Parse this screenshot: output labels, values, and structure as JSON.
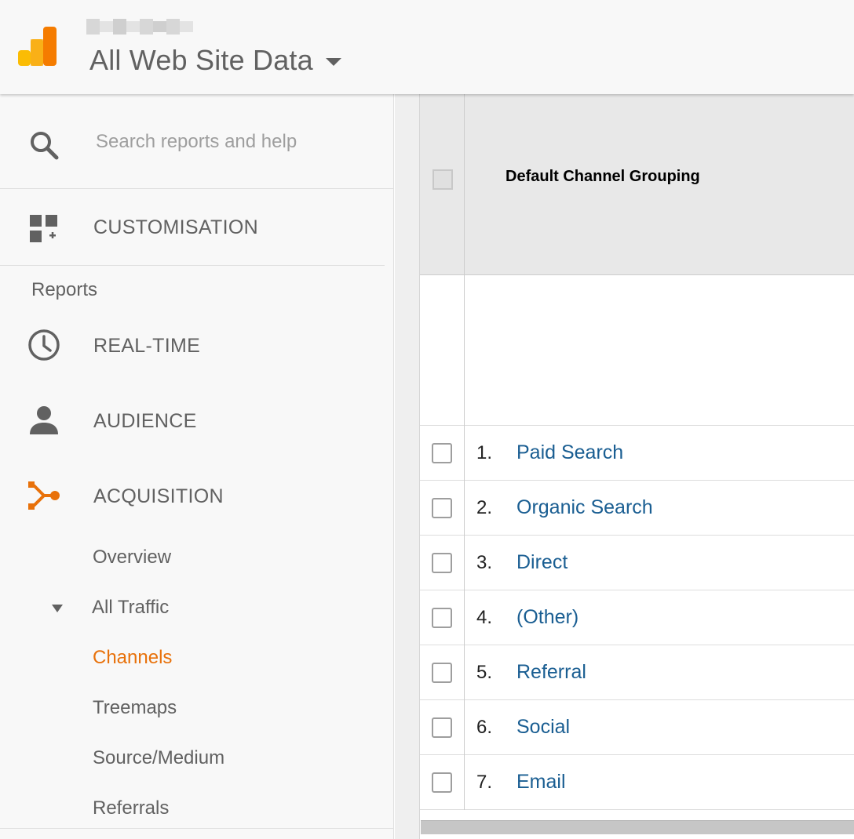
{
  "header": {
    "property_title": "All Web Site Data"
  },
  "sidebar": {
    "search": {
      "placeholder": "Search reports and help"
    },
    "customisation_label": "CUSTOMISATION",
    "reports_title": "Reports",
    "nav": [
      {
        "label": "REAL-TIME",
        "icon": "clock-icon"
      },
      {
        "label": "AUDIENCE",
        "icon": "person-icon"
      },
      {
        "label": "ACQUISITION",
        "icon": "acquisition-icon",
        "active": true
      }
    ],
    "acquisition": {
      "overview": "Overview",
      "all_traffic": "All Traffic",
      "items": [
        "Channels",
        "Treemaps",
        "Source/Medium",
        "Referrals"
      ],
      "active_item": "Channels"
    }
  },
  "table": {
    "column_header": "Default Channel Grouping",
    "rows": [
      {
        "num": "1.",
        "label": "Paid Search"
      },
      {
        "num": "2.",
        "label": "Organic Search"
      },
      {
        "num": "3.",
        "label": "Direct"
      },
      {
        "num": "4.",
        "label": "(Other)"
      },
      {
        "num": "5.",
        "label": "Referral"
      },
      {
        "num": "6.",
        "label": "Social"
      },
      {
        "num": "7.",
        "label": "Email"
      }
    ]
  },
  "colors": {
    "accent_orange": "#e8710a",
    "link_blue": "#1a5e92",
    "logo_yellow": "#fbbc04",
    "logo_orange": "#f57c00"
  }
}
